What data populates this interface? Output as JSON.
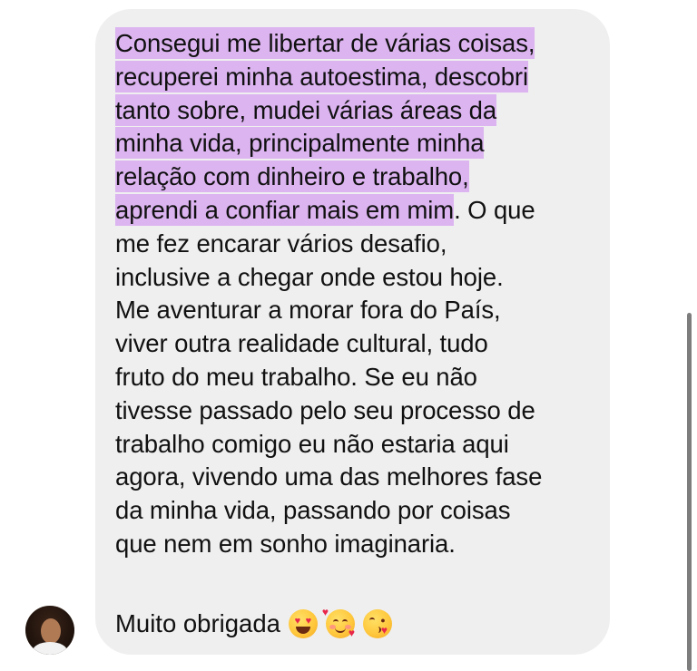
{
  "message": {
    "highlighted_lines": [
      "Consegui me libertar de várias coisas,",
      "recuperei minha autoestima, descobri",
      "tanto sobre, mudei várias áreas da",
      "minha vida, principalmente minha",
      "relação com dinheiro e trabalho,"
    ],
    "mixed_line_highlight": "aprendi a confiar mais em mim",
    "mixed_line_rest": ". O que",
    "plain_lines": [
      "me fez encarar vários desafio,",
      "inclusive a chegar onde estou hoje.",
      "Me aventurar a morar fora do País,",
      "viver outra realidade cultural, tudo",
      "fruto do meu trabalho. Se eu não",
      "tivesse passado pelo seu processo de",
      "trabalho comigo eu não estaria aqui",
      "agora, vivendo uma das melhores fase",
      "da minha vida, passando por coisas",
      "que nem em sonho imaginaria."
    ],
    "thanks": "Muito obrigada",
    "highlight_color": "#dcb4f0",
    "bubble_color": "#efeff0",
    "emojis": [
      "heart-eyes-emoji",
      "smiling-face-with-hearts-emoji",
      "face-blowing-kiss-emoji"
    ]
  }
}
